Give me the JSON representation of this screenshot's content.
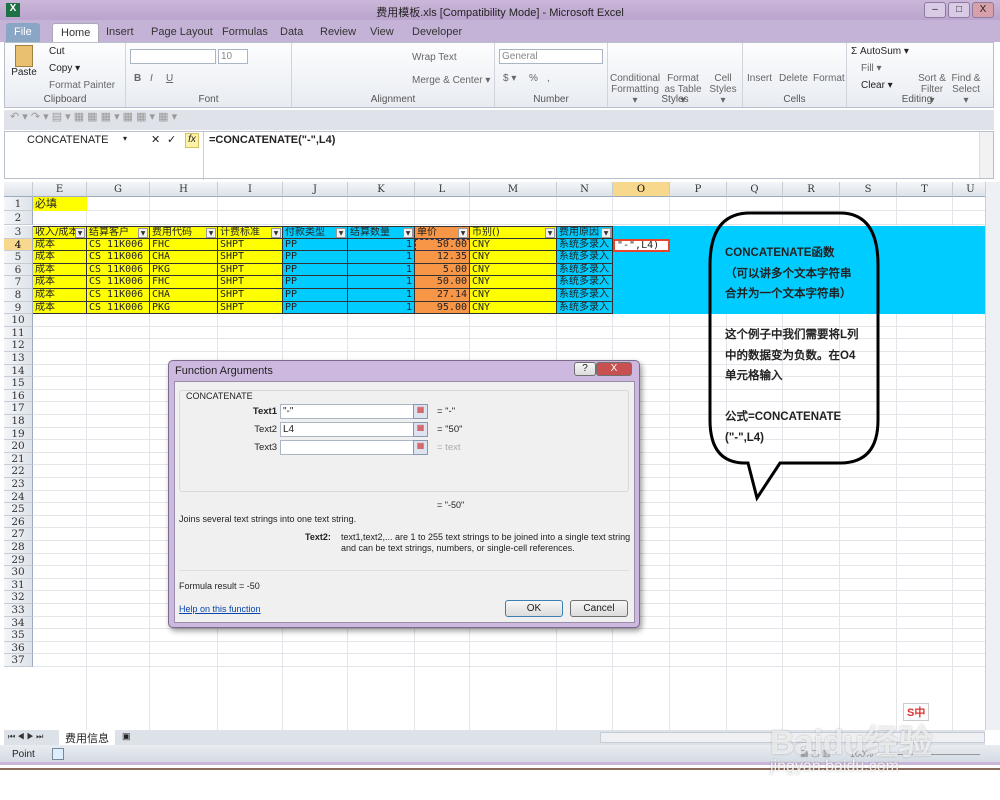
{
  "window": {
    "title": "费用模板.xls  [Compatibility Mode]  -  Microsoft Excel",
    "minimize": "–",
    "maximize": "□",
    "close": "X"
  },
  "ribbon_tabs": [
    "File",
    "Home",
    "Insert",
    "Page Layout",
    "Formulas",
    "Data",
    "Review",
    "View",
    "Developer"
  ],
  "ribbon": {
    "clipboard": {
      "label": "Clipboard",
      "paste": "Paste",
      "cut": "Cut",
      "copy": "Copy ▾",
      "format_painter": "Format Painter"
    },
    "font": {
      "label": "Font",
      "size": "10",
      "bold": "B",
      "italic": "I",
      "underline": "U"
    },
    "alignment": {
      "label": "Alignment",
      "wrap": "Wrap Text",
      "merge": "Merge & Center ▾"
    },
    "number": {
      "label": "Number",
      "format": "General",
      "currency": "$ ▾",
      "percent": "%",
      "comma": ","
    },
    "styles": {
      "label": "Styles",
      "conditional": "Conditional Formatting ▾",
      "format_table": "Format as Table ▾",
      "cell_styles": "Cell Styles ▾"
    },
    "cells": {
      "label": "Cells",
      "insert": "Insert",
      "delete": "Delete",
      "format": "Format"
    },
    "editing": {
      "label": "Editing",
      "autosum": "Σ AutoSum ▾",
      "fill": "Fill ▾",
      "clear": "Clear ▾",
      "sort": "Sort & Filter ▾",
      "find": "Find & Select ▾"
    }
  },
  "formula_bar": {
    "name_box": "CONCATENATE",
    "cancel": "✕",
    "enter": "✓",
    "fx": "fx",
    "formula": "=CONCATENATE(\"-\",L4)"
  },
  "columns": [
    "E",
    "G",
    "H",
    "I",
    "J",
    "K",
    "L",
    "M",
    "N",
    "O",
    "P",
    "Q",
    "R",
    "S",
    "T",
    "U"
  ],
  "selected_column": "O",
  "selected_row": 4,
  "row_count": 37,
  "cells": {
    "E1": "必填",
    "headers": [
      "收入/成本",
      "结算客户",
      "费用代码",
      "计费标准",
      "付款类型",
      "结算数量",
      "单价",
      "币别()",
      "费用原因"
    ],
    "rows": [
      [
        "成本",
        "CS 11K006",
        "FHC",
        "SHPT",
        "PP",
        "1",
        "50.00",
        "CNY",
        "系统多录入"
      ],
      [
        "成本",
        "CS 11K006",
        "CHA",
        "SHPT",
        "PP",
        "1",
        "12.35",
        "CNY",
        "系统多录入"
      ],
      [
        "成本",
        "CS 11K006",
        "PKG",
        "SHPT",
        "PP",
        "1",
        "5.00",
        "CNY",
        "系统多录入"
      ],
      [
        "成本",
        "CS 11K006",
        "FHC",
        "SHPT",
        "PP",
        "1",
        "50.00",
        "CNY",
        "系统多录入"
      ],
      [
        "成本",
        "CS 11K006",
        "CHA",
        "SHPT",
        "PP",
        "1",
        "27.14",
        "CNY",
        "系统多录入"
      ],
      [
        "成本",
        "CS 11K006",
        "PKG",
        "SHPT",
        "PP",
        "1",
        "95.00",
        "CNY",
        "系统多录入"
      ]
    ],
    "O4": "\"-\",L4)"
  },
  "colors": {
    "yellow": "#ffff00",
    "cyan": "#00ccff",
    "orange": "#f79646",
    "selection": "#e8452a"
  },
  "callout": {
    "lines": [
      "CONCATENATE函数",
      "（可以讲多个文本字符串",
      "合并为一个文本字符串）",
      "",
      "这个例子中我们需要将L列",
      "中的数据变为负数。在O4",
      "单元格输入",
      "",
      "公式=CONCATENATE",
      "(\"-\",L4)"
    ]
  },
  "dialog": {
    "title": "Function Arguments",
    "help_btn": "?",
    "close_btn": "X",
    "function": "CONCATENATE",
    "args": [
      {
        "label": "Text1",
        "value": "\"-\"",
        "result": "= \"-\""
      },
      {
        "label": "Text2",
        "value": "L4",
        "result": "= \"50\""
      },
      {
        "label": "Text3",
        "value": "",
        "result": "= text"
      }
    ],
    "overall_result": "= \"-50\"",
    "description": "Joins several text strings into one text string.",
    "arg_name": "Text2:",
    "arg_help": "text1,text2,... are 1 to 255 text strings to be joined into a single text string and can be text strings, numbers, or single-cell references.",
    "formula_result": "Formula result =   -50",
    "help_link": "Help on this function",
    "ok": "OK",
    "cancel": "Cancel"
  },
  "sheet_tabs": [
    "费用信息"
  ],
  "status": {
    "mode": "Point",
    "zoom": "100%"
  },
  "watermark": "Baidu经验 jingyan.baidu.com",
  "ime": "S中"
}
